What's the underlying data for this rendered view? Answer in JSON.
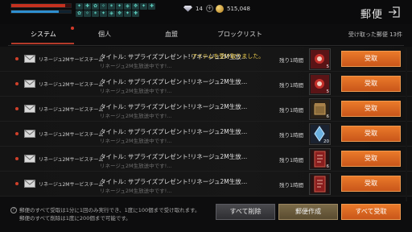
{
  "header": {
    "title": "郵便",
    "hp_fraction": 0.9,
    "mp_fraction": 0.8,
    "buff_icons": [
      "✦",
      "✚",
      "✿",
      "✧",
      "✶",
      "✦",
      "◈",
      "✥",
      "✦",
      "✚",
      "✿",
      "✧",
      "✶",
      "✦",
      "◈",
      "✥",
      "✦",
      "✚"
    ],
    "diamonds": "14",
    "gold": "515,048"
  },
  "tabs": [
    {
      "label": "システム",
      "active": true
    },
    {
      "label": "個人",
      "active": false
    },
    {
      "label": "血盟",
      "active": false
    },
    {
      "label": "ブロックリスト",
      "active": false
    }
  ],
  "mail_count": "受け取った郵便 13件",
  "toast": "アイテムを受け取りました。",
  "mails": [
    {
      "sender": "リネージュ2Mサービスチーム",
      "subject": "タイトル: サプライズプレゼント!リネージュ2M生放…",
      "preview": "リネージュ2M生放送中です!…",
      "time": "残り1時間",
      "item": "red-scroll",
      "qty": "5",
      "claim": "受取"
    },
    {
      "sender": "リネージュ2Mサービスチーム",
      "subject": "タイトル: サプライズプレゼント!リネージュ2M生放…",
      "preview": "リネージュ2M生放送中です!…",
      "time": "残り1時間",
      "item": "red-scroll",
      "qty": "5",
      "claim": "受取"
    },
    {
      "sender": "リネージュ2Mサービスチーム",
      "subject": "タイトル: サプライズプレゼント!リネージュ2M生放…",
      "preview": "リネージュ2M生放送中です!…",
      "time": "残り1時間",
      "item": "bronze-box",
      "qty": "6",
      "claim": "受取"
    },
    {
      "sender": "リネージュ2Mサービスチーム",
      "subject": "タイトル: サプライズプレゼント!リネージュ2M生放…",
      "preview": "リネージュ2M生放送中です!…",
      "time": "残り1時間",
      "item": "blue-crystal",
      "qty": "20",
      "claim": "受取"
    },
    {
      "sender": "リネージュ2Mサービスチーム",
      "subject": "タイトル: サプライズプレゼント!リネージュ2M生放…",
      "preview": "リネージュ2M生放送中です!…",
      "time": "残り1時間",
      "item": "red-card",
      "qty": "6",
      "claim": "受取"
    },
    {
      "sender": "リネージュ2Mサービスチーム",
      "subject": "タイトル: サプライズプレゼント!リネージュ2M生放…",
      "preview": "リネージュ2M生放送中です!…",
      "time": "残り1時間",
      "item": "red-card",
      "qty": "",
      "claim": "受取"
    }
  ],
  "footer": {
    "note_line1": "郵便のすべて受取は1分に1回のみ実行でき、1度に100個まで受け取れます。",
    "note_line2": "郵便のすべて削除は1度に200個まで可能です。",
    "delete_all": "すべて削除",
    "compose": "郵便作成",
    "claim_all": "すべて受取"
  },
  "colors": {
    "accent_orange": "#d9661f",
    "tab_underline": "#b43a2a",
    "toast_yellow": "#e8c84a"
  }
}
